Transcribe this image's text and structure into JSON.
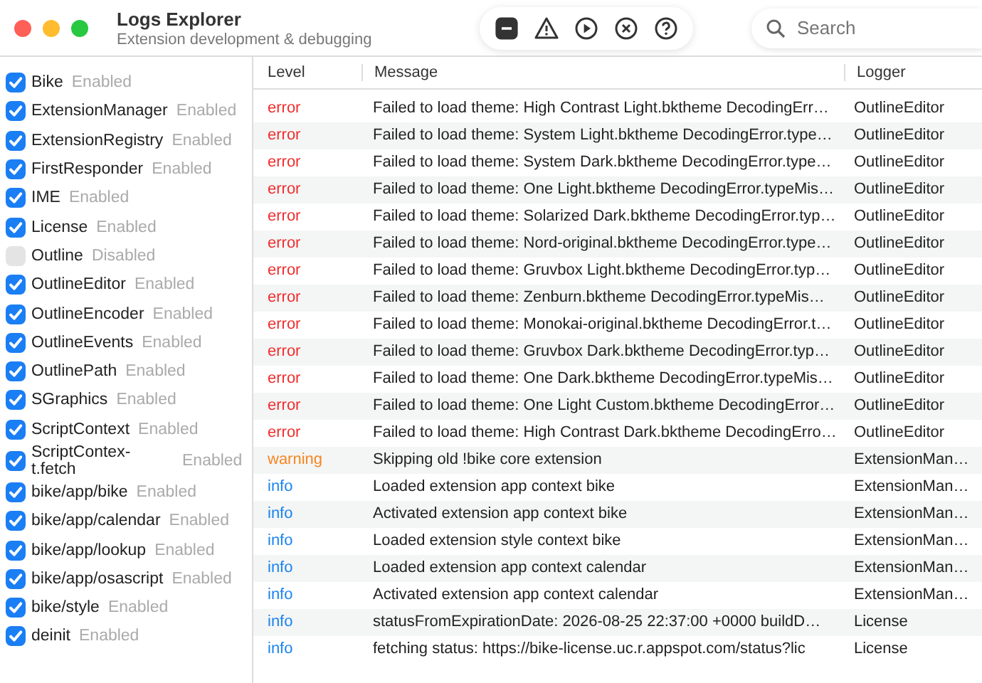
{
  "window": {
    "title": "Logs Explorer",
    "subtitle": "Extension development & debugging"
  },
  "toolbar_buttons": [
    {
      "kind": "minus"
    },
    {
      "kind": "warning"
    },
    {
      "kind": "play"
    },
    {
      "kind": "close"
    },
    {
      "kind": "help"
    }
  ],
  "search": {
    "placeholder": "Search"
  },
  "sidebar": {
    "items": [
      {
        "name": "Bike",
        "status": "Enabled",
        "checked": true
      },
      {
        "name": "ExtensionManager",
        "status": "Enabled",
        "checked": true
      },
      {
        "name": "ExtensionRegistry",
        "status": "Enabled",
        "checked": true
      },
      {
        "name": "FirstResponder",
        "status": "Enabled",
        "checked": true
      },
      {
        "name": "IME",
        "status": "Enabled",
        "checked": true
      },
      {
        "name": "License",
        "status": "Enabled",
        "checked": true
      },
      {
        "name": "Outline",
        "status": "Disabled",
        "checked": false
      },
      {
        "name": "OutlineEditor",
        "status": "Enabled",
        "checked": true
      },
      {
        "name": "OutlineEncoder",
        "status": "Enabled",
        "checked": true
      },
      {
        "name": "OutlineEvents",
        "status": "Enabled",
        "checked": true
      },
      {
        "name": "OutlinePath",
        "status": "Enabled",
        "checked": true
      },
      {
        "name": "SGraphics",
        "status": "Enabled",
        "checked": true
      },
      {
        "name": "ScriptContext",
        "status": "Enabled",
        "checked": true
      },
      {
        "name": "ScriptContex-t.fetch",
        "status": "Enabled",
        "checked": true
      },
      {
        "name": "bike/app/bike",
        "status": "Enabled",
        "checked": true
      },
      {
        "name": "bike/app/calendar",
        "status": "Enabled",
        "checked": true
      },
      {
        "name": "bike/app/lookup",
        "status": "Enabled",
        "checked": true
      },
      {
        "name": "bike/app/osascript",
        "status": "Enabled",
        "checked": true
      },
      {
        "name": "bike/style",
        "status": "Enabled",
        "checked": true
      },
      {
        "name": "deinit",
        "status": "Enabled",
        "checked": true
      }
    ]
  },
  "table": {
    "columns": [
      "Level",
      "Message",
      "Logger"
    ],
    "rows": [
      {
        "kind": "error",
        "level": "error",
        "message": "Failed to load theme: High Contrast Light.bktheme DecodingErr…",
        "logger": "OutlineEditor"
      },
      {
        "kind": "error",
        "level": "error",
        "message": "Failed to load theme: System Light.bktheme DecodingError.type…",
        "logger": "OutlineEditor"
      },
      {
        "kind": "error",
        "level": "error",
        "message": "Failed to load theme: System Dark.bktheme DecodingError.type…",
        "logger": "OutlineEditor"
      },
      {
        "kind": "error",
        "level": "error",
        "message": "Failed to load theme: One Light.bktheme DecodingError.typeMis…",
        "logger": "OutlineEditor"
      },
      {
        "kind": "error",
        "level": "error",
        "message": "Failed to load theme: Solarized Dark.bktheme DecodingError.typ…",
        "logger": "OutlineEditor"
      },
      {
        "kind": "error",
        "level": "error",
        "message": "Failed to load theme: Nord-original.bktheme DecodingError.type…",
        "logger": "OutlineEditor"
      },
      {
        "kind": "error",
        "level": "error",
        "message": "Failed to load theme: Gruvbox Light.bktheme DecodingError.typ…",
        "logger": "OutlineEditor"
      },
      {
        "kind": "error",
        "level": "error",
        "message": "Failed to load theme: Zenburn.bktheme DecodingError.typeMis…",
        "logger": "OutlineEditor"
      },
      {
        "kind": "error",
        "level": "error",
        "message": "Failed to load theme: Monokai-original.bktheme DecodingError.t…",
        "logger": "OutlineEditor"
      },
      {
        "kind": "error",
        "level": "error",
        "message": "Failed to load theme: Gruvbox Dark.bktheme DecodingError.typ…",
        "logger": "OutlineEditor"
      },
      {
        "kind": "error",
        "level": "error",
        "message": "Failed to load theme: One Dark.bktheme DecodingError.typeMis…",
        "logger": "OutlineEditor"
      },
      {
        "kind": "error",
        "level": "error",
        "message": "Failed to load theme: One Light Custom.bktheme DecodingError…",
        "logger": "OutlineEditor"
      },
      {
        "kind": "error",
        "level": "error",
        "message": "Failed to load theme: High Contrast Dark.bktheme DecodingErro…",
        "logger": "OutlineEditor"
      },
      {
        "kind": "warning",
        "level": "warning",
        "message": "Skipping old !bike core extension",
        "logger": "ExtensionMan…"
      },
      {
        "kind": "info",
        "level": "info",
        "message": "Loaded extension app context bike",
        "logger": "ExtensionMan…"
      },
      {
        "kind": "info",
        "level": "info",
        "message": "Activated extension app context bike",
        "logger": "ExtensionMan…"
      },
      {
        "kind": "info",
        "level": "info",
        "message": "Loaded extension style context bike",
        "logger": "ExtensionMan…"
      },
      {
        "kind": "info",
        "level": "info",
        "message": "Loaded extension app context calendar",
        "logger": "ExtensionMan…"
      },
      {
        "kind": "info",
        "level": "info",
        "message": "Activated extension app context calendar",
        "logger": "ExtensionMan…"
      },
      {
        "kind": "info",
        "level": "info",
        "message": "statusFromExpirationDate: 2026-08-25 22:37:00 +0000 buildD…",
        "logger": "License"
      },
      {
        "kind": "info",
        "level": "info",
        "message": "fetching status: https://bike-license.uc.r.appspot.com/status?lic",
        "logger": "License"
      }
    ]
  }
}
